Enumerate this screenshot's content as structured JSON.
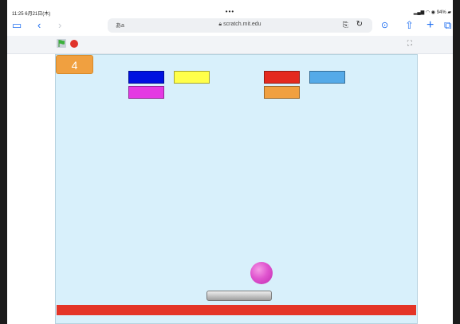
{
  "statusbar": {
    "time": "11:25  6月21日(木)",
    "dots": "•••",
    "battery": "94%"
  },
  "browser": {
    "url": "scratch.mit.edu",
    "aa_label": "あa"
  },
  "game": {
    "score": "4",
    "colors": {
      "stage_bg": "#d8f0fb",
      "floor": "#e43527",
      "score_badge": "#f0a040",
      "ball": "#e055cf",
      "paddle": "#aaaaaa",
      "stop": "#e0332b"
    },
    "bricks": [
      {
        "color": "#0011e0",
        "row": 1,
        "col": 1
      },
      {
        "color": "#ffff4a",
        "row": 1,
        "col": 2
      },
      {
        "color": "#e42a1f",
        "row": 1,
        "col": 3
      },
      {
        "color": "#55aae8",
        "row": 1,
        "col": 4
      },
      {
        "color": "#e43ae3",
        "row": 2,
        "col": 1
      },
      {
        "color": "#f0a040",
        "row": 2,
        "col": 3
      }
    ]
  }
}
